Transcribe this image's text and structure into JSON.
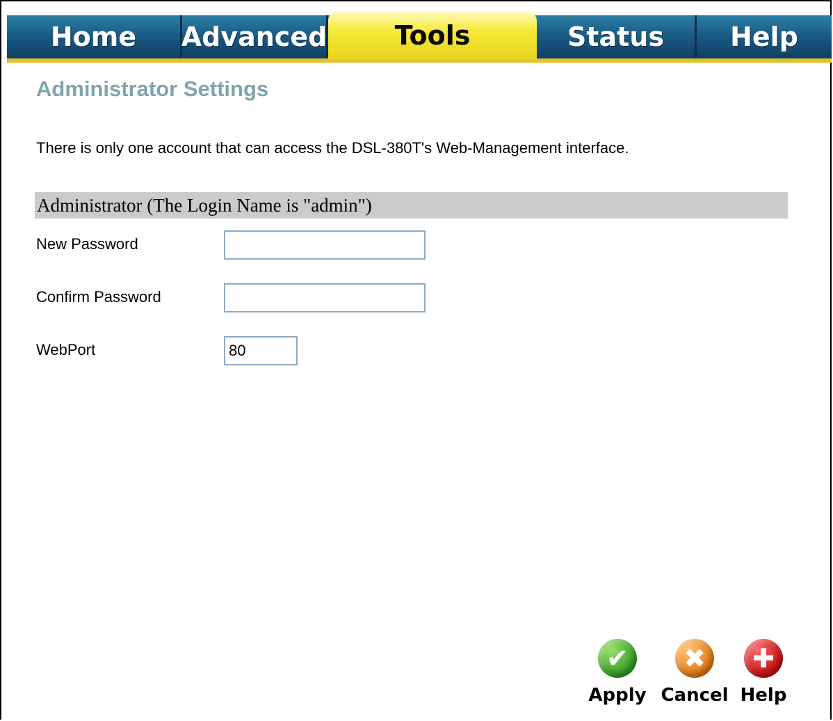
{
  "tabs": [
    {
      "label": "Home",
      "active": false
    },
    {
      "label": "Advanced",
      "active": false
    },
    {
      "label": "Tools",
      "active": true
    },
    {
      "label": "Status",
      "active": false
    },
    {
      "label": "Help",
      "active": false
    }
  ],
  "page": {
    "title": "Administrator Settings",
    "intro": "There is only one account that can access the DSL-380T's Web-Management interface."
  },
  "section": {
    "header": "Administrator (The Login Name is \"admin\")"
  },
  "fields": {
    "new_password": {
      "label": "New Password",
      "value": ""
    },
    "confirm_password": {
      "label": "Confirm Password",
      "value": ""
    },
    "web_port": {
      "label": "WebPort",
      "value": "80"
    }
  },
  "buttons": {
    "apply": {
      "label": "Apply",
      "icon": "check-icon"
    },
    "cancel": {
      "label": "Cancel",
      "icon": "x-icon"
    },
    "help": {
      "label": "Help",
      "icon": "plus-icon"
    }
  },
  "colors": {
    "tab_bar": "#1a5c86",
    "active_tab": "#f6ea3a",
    "title": "#7fa5ac",
    "section_header_bg": "#cbcbcb"
  }
}
